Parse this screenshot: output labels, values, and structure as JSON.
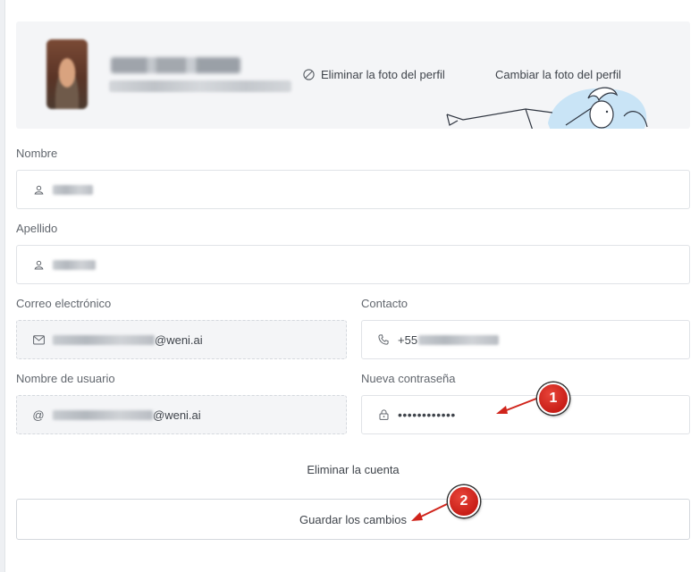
{
  "profile": {
    "remove_photo_label": "Eliminar la foto del perfil",
    "change_photo_label": "Cambiar la foto del perfil"
  },
  "form": {
    "first_name": {
      "label": "Nombre",
      "icon": "user-icon"
    },
    "last_name": {
      "label": "Apellido",
      "icon": "user-icon"
    },
    "email": {
      "label": "Correo electrónico",
      "icon": "mail-icon",
      "visible_suffix": "@weni.ai"
    },
    "contact": {
      "label": "Contacto",
      "icon": "phone-icon",
      "visible_prefix": "+55"
    },
    "username": {
      "label": "Nombre de usuario",
      "icon": "at-icon",
      "visible_suffix": "@weni.ai"
    },
    "new_password": {
      "label": "Nueva contraseña",
      "icon": "lock-icon",
      "value": "••••••••••••"
    }
  },
  "actions": {
    "delete_account_label": "Eliminar la cuenta",
    "save_label": "Guardar los cambios"
  },
  "annotations": [
    {
      "number": "1",
      "color": "#d0241b"
    },
    {
      "number": "2",
      "color": "#d0241b"
    }
  ]
}
